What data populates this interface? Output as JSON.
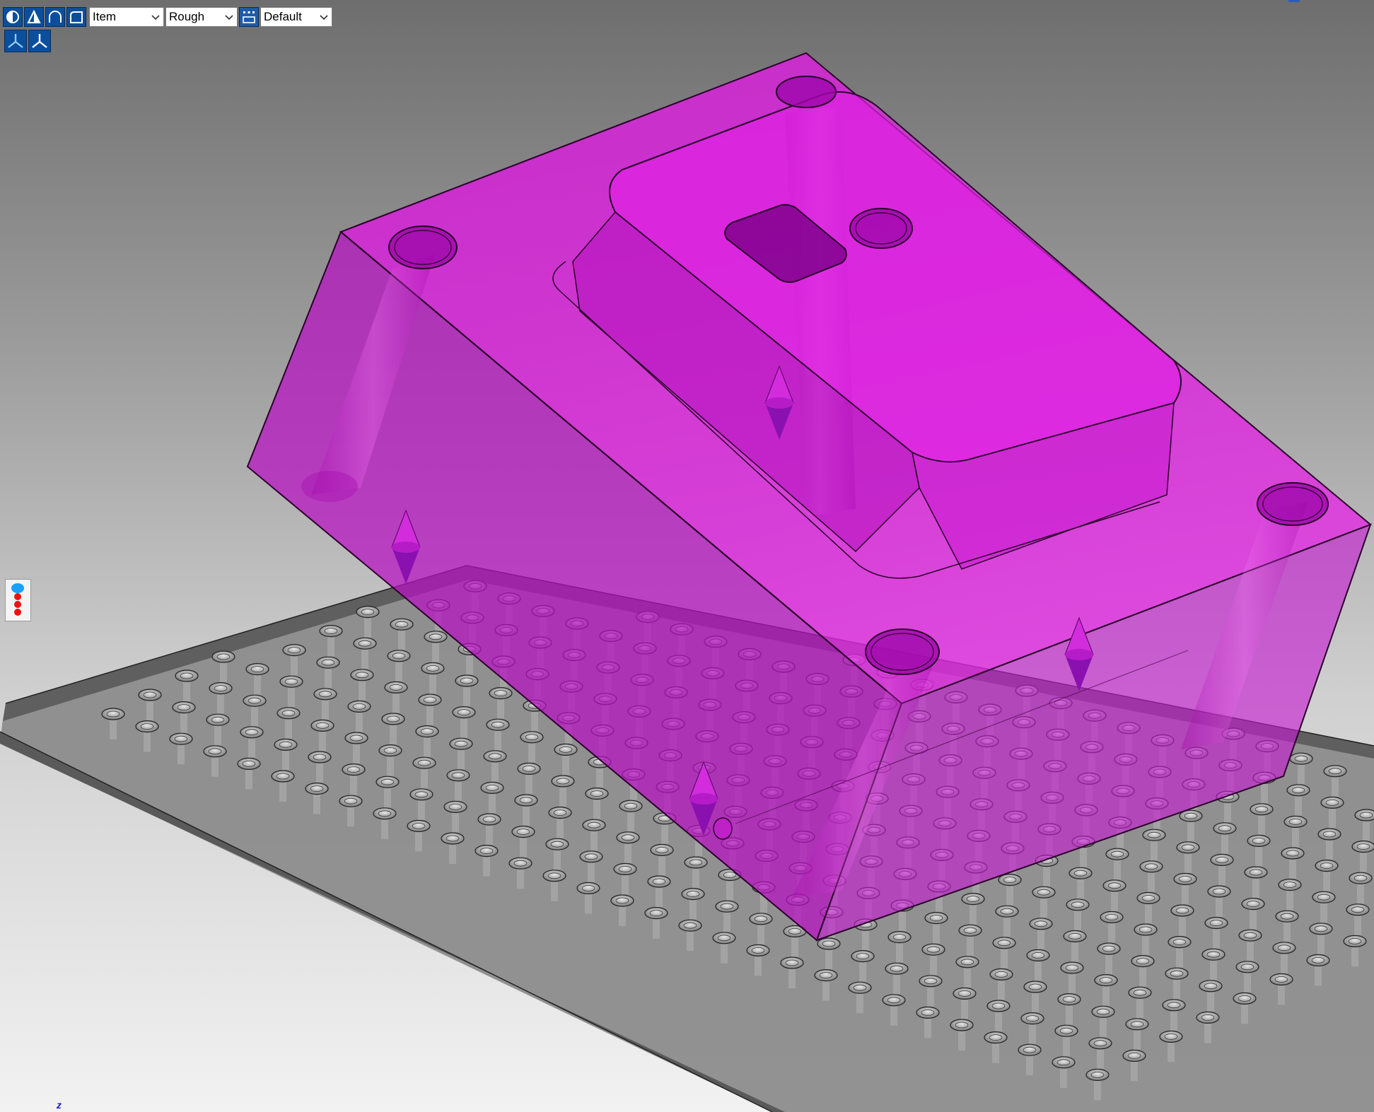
{
  "toolbar": {
    "buttons": [
      {
        "icon": "circle-shade-icon"
      },
      {
        "icon": "triangle-shade-icon"
      },
      {
        "icon": "arch-icon"
      },
      {
        "icon": "box-shade-icon"
      }
    ],
    "mode_select": {
      "value": "Item"
    },
    "quality_select": {
      "value": "Rough"
    },
    "layer_icon": "layer-grid-icon",
    "style_select": {
      "value": "Default"
    }
  },
  "view_buttons": [
    {
      "icon": "axis-tripod-icon"
    },
    {
      "icon": "axis-tripod-alt-icon"
    }
  ],
  "side_widget": {
    "icon": "marker-balls-icon"
  },
  "axis": {
    "z_label": "z"
  },
  "colors": {
    "part": "#d81ad8",
    "plate": "#8e8e8e",
    "toolbar_button": "#0b4f9c",
    "axis_label": "#1a1ad0"
  }
}
